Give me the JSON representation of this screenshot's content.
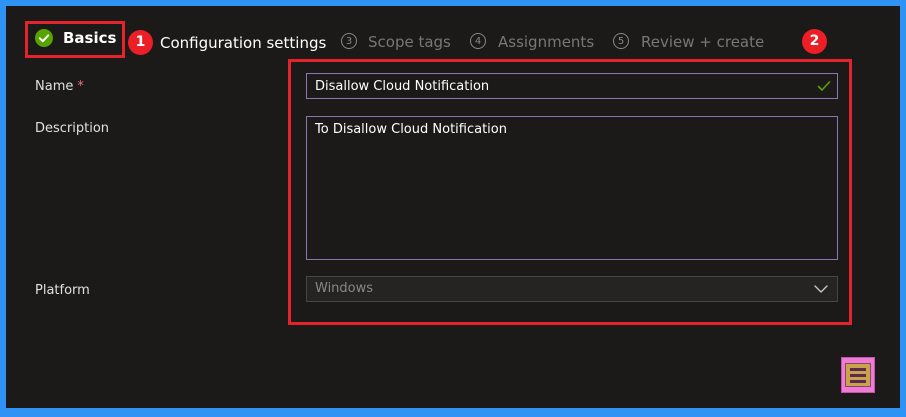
{
  "wizard": {
    "steps": [
      {
        "number": "",
        "label": "Basics",
        "state": "completed"
      },
      {
        "number": "1",
        "label": "Configuration settings",
        "state": "active"
      },
      {
        "number": "3",
        "label": "Scope tags",
        "state": "disabled"
      },
      {
        "number": "4",
        "label": "Assignments",
        "state": "disabled"
      },
      {
        "number": "5",
        "label": "Review + create",
        "state": "disabled"
      }
    ]
  },
  "annotations": {
    "badge_2": "2"
  },
  "form": {
    "name": {
      "label": "Name",
      "required_mark": "*",
      "value": "Disallow Cloud Notification",
      "valid": true
    },
    "description": {
      "label": "Description",
      "value": "To Disallow Cloud Notification"
    },
    "platform": {
      "label": "Platform",
      "value": "Windows"
    }
  },
  "colors": {
    "background": "#1b1a19",
    "border_outer": "#2e93f4",
    "highlight_red": "#e3242b",
    "success_green": "#57a300",
    "input_border": "#8a76b0"
  },
  "icons": {
    "completed": "check-circle-icon",
    "valid": "check-icon",
    "dropdown": "chevron-down-icon"
  }
}
